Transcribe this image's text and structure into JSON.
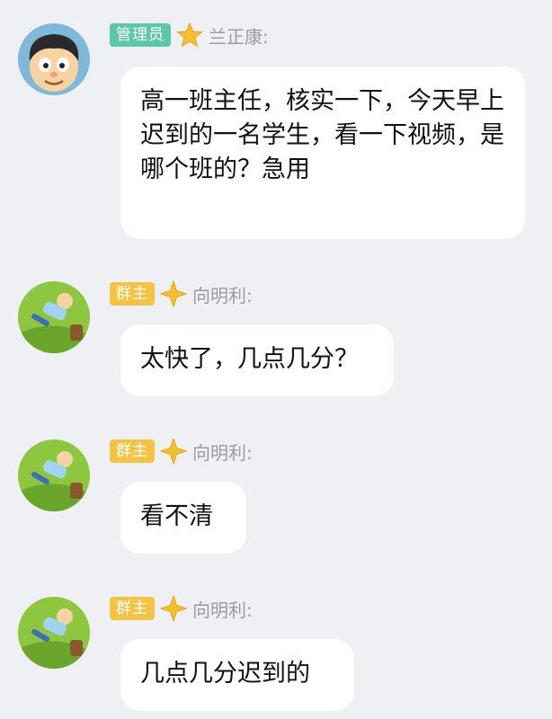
{
  "colors": {
    "background": "#eef0f4",
    "bubble": "#ffffff",
    "admin_badge": "#5cc8a8",
    "owner_badge": "#f5c343",
    "name_text": "#9a9ca2"
  },
  "messages": [
    {
      "avatar_icon": "cartoon-boy-avatar-icon",
      "badge": "管理员",
      "badge_icon": "gold-star-icon",
      "sender": "兰正康:",
      "text": "高一班主任，核实一下，今天早上迟到的一名学生，看一下视频，是哪个班的？急用"
    },
    {
      "avatar_icon": "boy-lying-on-grass-avatar-icon",
      "badge": "群主",
      "badge_icon": "gold-diamond-star-icon",
      "sender": "向明利:",
      "text": "太快了，几点几分？"
    },
    {
      "avatar_icon": "boy-lying-on-grass-avatar-icon",
      "badge": "群主",
      "badge_icon": "gold-diamond-star-icon",
      "sender": "向明利:",
      "text": "看不清"
    },
    {
      "avatar_icon": "boy-lying-on-grass-avatar-icon",
      "badge": "群主",
      "badge_icon": "gold-diamond-star-icon",
      "sender": "向明利:",
      "text": "几点几分迟到的"
    }
  ]
}
